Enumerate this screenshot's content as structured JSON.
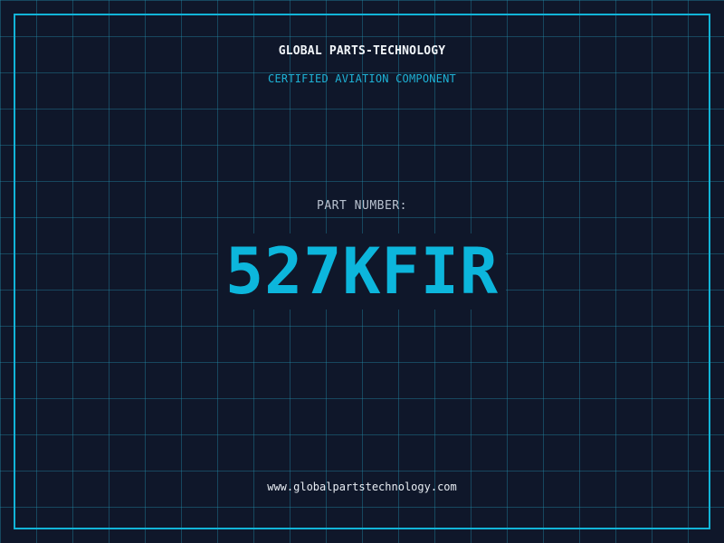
{
  "header": {
    "company_name": "GLOBAL PARTS-TECHNOLOGY",
    "tagline": "CERTIFIED AVIATION COMPONENT"
  },
  "part": {
    "label": "PART NUMBER:",
    "number": "527KFIR"
  },
  "footer": {
    "website": "www.globalpartstechnology.com"
  },
  "colors": {
    "background": "#0f172a",
    "accent": "#0cb6dc",
    "grid": "#228aa8",
    "text": "#f1f5f9"
  }
}
